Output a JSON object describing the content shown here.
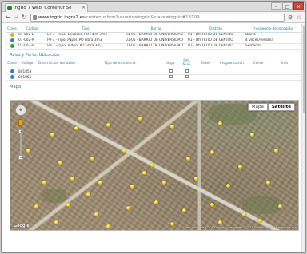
{
  "browser": {
    "tab_title": "Ingrid 7 Web. Contenur Se",
    "url_host": "www.ingrid.ingra2.es",
    "url_path": "/contenur.htm?usuario=ingrid&clave=ingrid#13109"
  },
  "containers": {
    "headers": [
      "Clase",
      "Código",
      "Tipo",
      "Barrio",
      "Distrito",
      "Frecuencia de recogida"
    ],
    "rows": [
      {
        "color": "#e0b21a",
        "code": "01-002-E",
        "type": "E-F3 - Tipo: Envases. PO Fibra 3m3",
        "barrio": "01-05 - BARRIO DE UNIVERSIDAD",
        "distrito": "01 - DISTRITO DE CENTRO",
        "freq": "Diario"
      },
      {
        "color": "#3b7cc4",
        "code": "01-002-P",
        "type": "P-F3 - Tipo: Papel. PO Fibra 3m3",
        "barrio": "01-05 - BARRIO DE UNIVERSIDAD",
        "distrito": "01 - DISTRITO DE CENTRO",
        "freq": "4 veces/semana"
      },
      {
        "color": "#3c9a3c",
        "code": "01-002-V",
        "type": "V-F3 - Tipo: Vidrio. PO Fibra 3m3",
        "barrio": "01-05 - BARRIO DE UNIVERSIDAD",
        "distrito": "01 - DISTRITO DE CENTRO",
        "freq": "Semanal"
      }
    ]
  },
  "avisos": {
    "section_title": "Aviso y Parte. Ubicación",
    "headers": [
      "Clase",
      "Código",
      "Descripción del aviso",
      "Tipo de incidencia",
      "Urge.",
      "Ord. Mun.",
      "Envío",
      "Programación",
      "Cierre",
      "Info"
    ],
    "rows": [
      {
        "color": "#3b7cc4",
        "code": "801858"
      },
      {
        "color": "#3b7cc4",
        "code": "801855"
      }
    ]
  },
  "map": {
    "section_title": "Mapa",
    "type_map": "Mapa",
    "type_satellite": "Satélite",
    "logo": "Google",
    "attribution": "Datos de mapa ©2013 Google · Imágenes ©2013 DigitalGlobe · Términos de uso"
  },
  "colors": {
    "link_blue": "#2a7ab0",
    "marker_yellow": "#e5c400"
  },
  "icons": [
    "back-arrow-icon",
    "forward-arrow-icon",
    "reload-icon",
    "star-icon",
    "wrench-icon",
    "pan-control-icon",
    "pegman-icon"
  ]
}
